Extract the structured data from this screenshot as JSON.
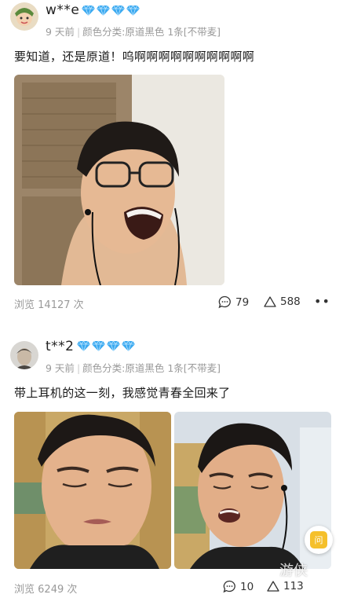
{
  "reviews": [
    {
      "username": "w**e",
      "time": "9 天前",
      "spec": "颜色分类:原道黑色 1条[不带麦]",
      "content": "要知道，还是原道！呜啊啊啊啊啊啊啊啊啊啊",
      "views_label": "浏览",
      "views": "14127",
      "views_unit": "次",
      "comments": "79",
      "likes": "588",
      "more": "••"
    },
    {
      "username": "t**2",
      "time": "9 天前",
      "spec": "颜色分类:原道黑色 1条[不带麦]",
      "content": "带上耳机的这一刻，我感觉青春全回来了",
      "views_label": "浏览",
      "views": "6249",
      "views_unit": "次",
      "comments": "10",
      "likes": "113",
      "more": "••"
    }
  ],
  "float_button": "问",
  "watermark": "游侠",
  "colors": {
    "diamond": "#3aa9f0",
    "meta": "#9a9a9a",
    "accent": "#f5c02b"
  }
}
